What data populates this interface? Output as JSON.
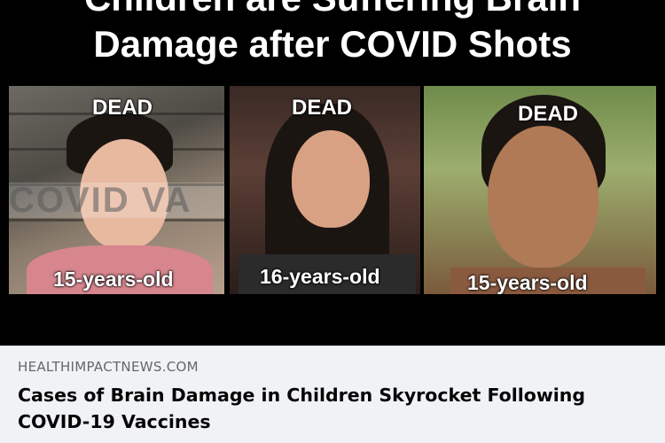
{
  "image": {
    "headline_line1": "Children are Suffering Brain",
    "headline_line2": "Damage after COVID Shots",
    "watermark": "COVID VA",
    "photos": [
      {
        "status": "DEAD",
        "age": "15-years-old"
      },
      {
        "status": "DEAD",
        "age": "16-years-old"
      },
      {
        "status": "DEAD",
        "age": "15-years-old"
      }
    ]
  },
  "link": {
    "source": "HEALTHIMPACTNEWS.COM",
    "title": "Cases of Brain Damage in Children Skyrocket Following COVID-19 Vaccines"
  },
  "colors": {
    "image_background": "#000000",
    "meta_background": "#f0f2f5",
    "source_text": "#65676b",
    "title_text": "#050505"
  }
}
